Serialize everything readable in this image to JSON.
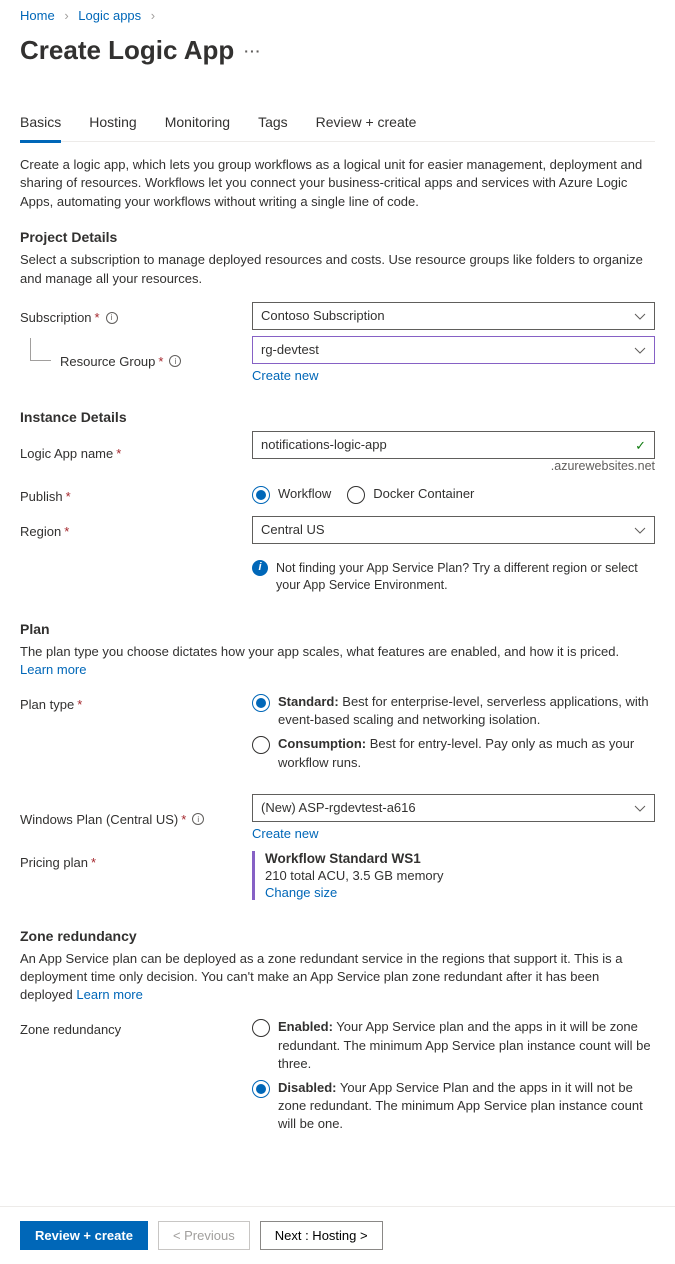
{
  "breadcrumb": {
    "home": "Home",
    "logic_apps": "Logic apps"
  },
  "title": "Create Logic App",
  "tabs": [
    "Basics",
    "Hosting",
    "Monitoring",
    "Tags",
    "Review + create"
  ],
  "intro": "Create a logic app, which lets you group workflows as a logical unit for easier management, deployment and sharing of resources. Workflows let you connect your business-critical apps and services with Azure Logic Apps, automating your workflows without writing a single line of code.",
  "project": {
    "heading": "Project Details",
    "desc": "Select a subscription to manage deployed resources and costs. Use resource groups like folders to organize and manage all your resources.",
    "subscription_label": "Subscription",
    "subscription_value": "Contoso Subscription",
    "rg_label": "Resource Group",
    "rg_value": "rg-devtest",
    "create_new": "Create new"
  },
  "instance": {
    "heading": "Instance Details",
    "name_label": "Logic App name",
    "name_value": "notifications-logic-app",
    "suffix": ".azurewebsites.net",
    "publish_label": "Publish",
    "publish_workflow": "Workflow",
    "publish_docker": "Docker Container",
    "region_label": "Region",
    "region_value": "Central US",
    "region_info": "Not finding your App Service Plan? Try a different region or select your App Service Environment."
  },
  "plan": {
    "heading": "Plan",
    "desc": "The plan type you choose dictates how your app scales, what features are enabled, and how it is priced. ",
    "learn_more": "Learn more",
    "type_label": "Plan type",
    "standard_name": "Standard:",
    "standard_desc": " Best for enterprise-level, serverless applications, with event-based scaling and networking isolation.",
    "consumption_name": "Consumption:",
    "consumption_desc": " Best for entry-level. Pay only as much as your workflow runs.",
    "win_plan_label": "Windows Plan (Central US)",
    "win_plan_value": "(New) ASP-rgdevtest-a616",
    "create_new": "Create new",
    "pricing_label": "Pricing plan",
    "pricing_name": "Workflow Standard WS1",
    "pricing_specs": "210 total ACU, 3.5 GB memory",
    "change_size": "Change size"
  },
  "zone": {
    "heading": "Zone redundancy",
    "desc": "An App Service plan can be deployed as a zone redundant service in the regions that support it. This is a deployment time only decision. You can't make an App Service plan zone redundant after it has been deployed ",
    "learn_more": "Learn more",
    "label": "Zone redundancy",
    "enabled_name": "Enabled:",
    "enabled_desc": " Your App Service plan and the apps in it will be zone redundant. The minimum App Service plan instance count will be three.",
    "disabled_name": "Disabled:",
    "disabled_desc": " Your App Service Plan and the apps in it will not be zone redundant. The minimum App Service plan instance count will be one."
  },
  "footer": {
    "review": "Review + create",
    "prev": "< Previous",
    "next": "Next : Hosting >"
  }
}
